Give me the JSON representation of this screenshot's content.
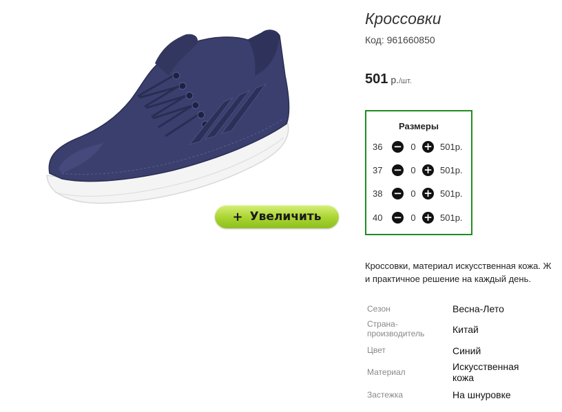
{
  "product": {
    "title": "Кроссовки",
    "code_label": "Код:",
    "code": "961660850",
    "price": "501",
    "currency": "р.",
    "unit": "/шт.",
    "zoom_button_label": "Увеличить",
    "zoom_icon": "plus-icon"
  },
  "sizes": {
    "title": "Размеры",
    "rows": [
      {
        "size": "36",
        "qty": "0",
        "price": "501р."
      },
      {
        "size": "37",
        "qty": "0",
        "price": "501р."
      },
      {
        "size": "38",
        "qty": "0",
        "price": "501р."
      },
      {
        "size": "40",
        "qty": "0",
        "price": "501р."
      }
    ],
    "minus_icon": "minus-circle-icon",
    "plus_icon": "plus-circle-icon",
    "border_color": "#1e8c1e"
  },
  "description": {
    "line1": "Кроссовки, материал искусственная кожа. Ж",
    "line2": "и практичное решение на каждый день."
  },
  "properties": [
    {
      "label": "Сезон",
      "value": "Весна-Лето"
    },
    {
      "label": "Страна-производитель",
      "value": "Китай"
    },
    {
      "label": "Цвет",
      "value": "Синий"
    },
    {
      "label": "Материал",
      "value": "Искусственная кожа"
    },
    {
      "label": "Застежка",
      "value": "На шнуровке"
    }
  ],
  "colors": {
    "accent_green": "#a9d430",
    "shoe_navy": "#3b3f6e"
  }
}
